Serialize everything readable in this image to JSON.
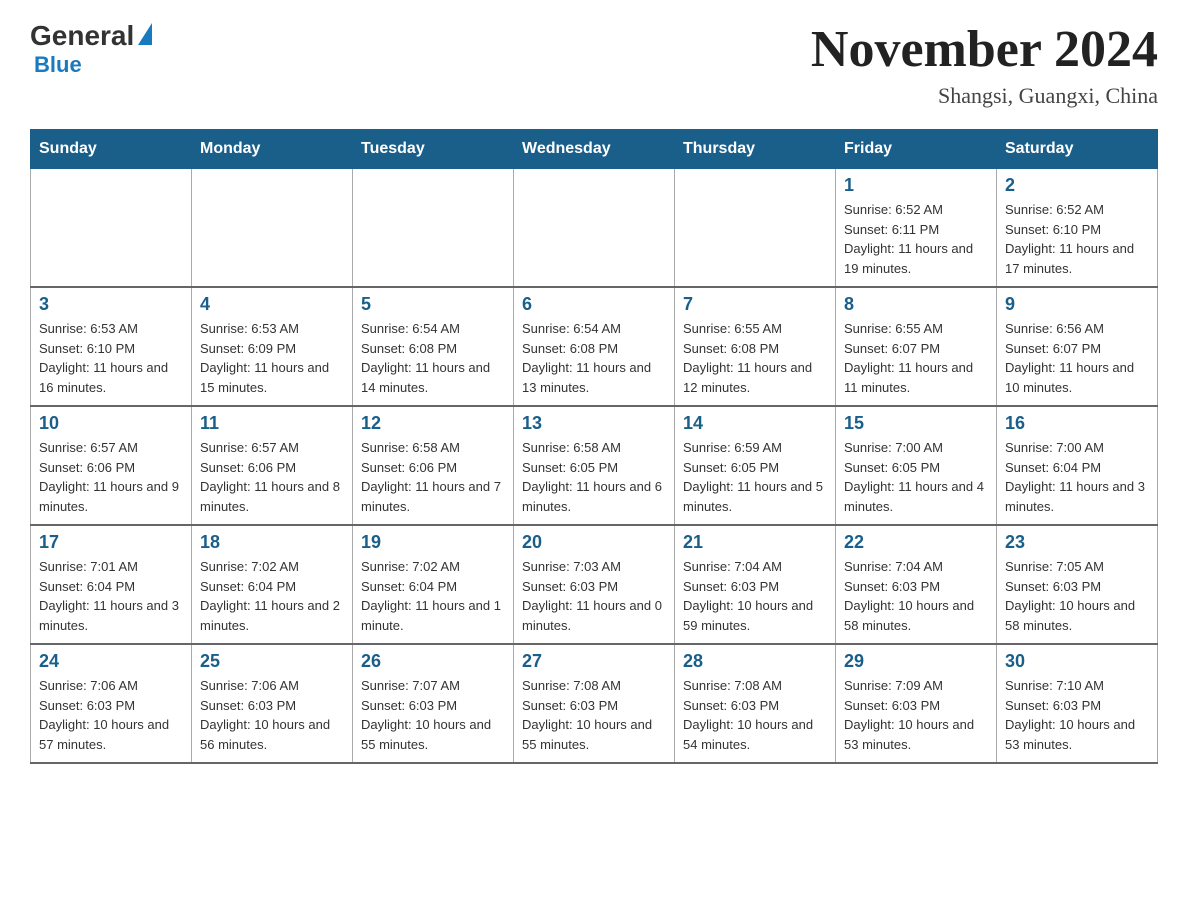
{
  "header": {
    "logo_general": "General",
    "logo_blue": "Blue",
    "month_title": "November 2024",
    "location": "Shangsi, Guangxi, China"
  },
  "days_of_week": [
    "Sunday",
    "Monday",
    "Tuesday",
    "Wednesday",
    "Thursday",
    "Friday",
    "Saturday"
  ],
  "weeks": [
    {
      "days": [
        {
          "num": "",
          "info": ""
        },
        {
          "num": "",
          "info": ""
        },
        {
          "num": "",
          "info": ""
        },
        {
          "num": "",
          "info": ""
        },
        {
          "num": "",
          "info": ""
        },
        {
          "num": "1",
          "info": "Sunrise: 6:52 AM\nSunset: 6:11 PM\nDaylight: 11 hours and 19 minutes."
        },
        {
          "num": "2",
          "info": "Sunrise: 6:52 AM\nSunset: 6:10 PM\nDaylight: 11 hours and 17 minutes."
        }
      ]
    },
    {
      "days": [
        {
          "num": "3",
          "info": "Sunrise: 6:53 AM\nSunset: 6:10 PM\nDaylight: 11 hours and 16 minutes."
        },
        {
          "num": "4",
          "info": "Sunrise: 6:53 AM\nSunset: 6:09 PM\nDaylight: 11 hours and 15 minutes."
        },
        {
          "num": "5",
          "info": "Sunrise: 6:54 AM\nSunset: 6:08 PM\nDaylight: 11 hours and 14 minutes."
        },
        {
          "num": "6",
          "info": "Sunrise: 6:54 AM\nSunset: 6:08 PM\nDaylight: 11 hours and 13 minutes."
        },
        {
          "num": "7",
          "info": "Sunrise: 6:55 AM\nSunset: 6:08 PM\nDaylight: 11 hours and 12 minutes."
        },
        {
          "num": "8",
          "info": "Sunrise: 6:55 AM\nSunset: 6:07 PM\nDaylight: 11 hours and 11 minutes."
        },
        {
          "num": "9",
          "info": "Sunrise: 6:56 AM\nSunset: 6:07 PM\nDaylight: 11 hours and 10 minutes."
        }
      ]
    },
    {
      "days": [
        {
          "num": "10",
          "info": "Sunrise: 6:57 AM\nSunset: 6:06 PM\nDaylight: 11 hours and 9 minutes."
        },
        {
          "num": "11",
          "info": "Sunrise: 6:57 AM\nSunset: 6:06 PM\nDaylight: 11 hours and 8 minutes."
        },
        {
          "num": "12",
          "info": "Sunrise: 6:58 AM\nSunset: 6:06 PM\nDaylight: 11 hours and 7 minutes."
        },
        {
          "num": "13",
          "info": "Sunrise: 6:58 AM\nSunset: 6:05 PM\nDaylight: 11 hours and 6 minutes."
        },
        {
          "num": "14",
          "info": "Sunrise: 6:59 AM\nSunset: 6:05 PM\nDaylight: 11 hours and 5 minutes."
        },
        {
          "num": "15",
          "info": "Sunrise: 7:00 AM\nSunset: 6:05 PM\nDaylight: 11 hours and 4 minutes."
        },
        {
          "num": "16",
          "info": "Sunrise: 7:00 AM\nSunset: 6:04 PM\nDaylight: 11 hours and 3 minutes."
        }
      ]
    },
    {
      "days": [
        {
          "num": "17",
          "info": "Sunrise: 7:01 AM\nSunset: 6:04 PM\nDaylight: 11 hours and 3 minutes."
        },
        {
          "num": "18",
          "info": "Sunrise: 7:02 AM\nSunset: 6:04 PM\nDaylight: 11 hours and 2 minutes."
        },
        {
          "num": "19",
          "info": "Sunrise: 7:02 AM\nSunset: 6:04 PM\nDaylight: 11 hours and 1 minute."
        },
        {
          "num": "20",
          "info": "Sunrise: 7:03 AM\nSunset: 6:03 PM\nDaylight: 11 hours and 0 minutes."
        },
        {
          "num": "21",
          "info": "Sunrise: 7:04 AM\nSunset: 6:03 PM\nDaylight: 10 hours and 59 minutes."
        },
        {
          "num": "22",
          "info": "Sunrise: 7:04 AM\nSunset: 6:03 PM\nDaylight: 10 hours and 58 minutes."
        },
        {
          "num": "23",
          "info": "Sunrise: 7:05 AM\nSunset: 6:03 PM\nDaylight: 10 hours and 58 minutes."
        }
      ]
    },
    {
      "days": [
        {
          "num": "24",
          "info": "Sunrise: 7:06 AM\nSunset: 6:03 PM\nDaylight: 10 hours and 57 minutes."
        },
        {
          "num": "25",
          "info": "Sunrise: 7:06 AM\nSunset: 6:03 PM\nDaylight: 10 hours and 56 minutes."
        },
        {
          "num": "26",
          "info": "Sunrise: 7:07 AM\nSunset: 6:03 PM\nDaylight: 10 hours and 55 minutes."
        },
        {
          "num": "27",
          "info": "Sunrise: 7:08 AM\nSunset: 6:03 PM\nDaylight: 10 hours and 55 minutes."
        },
        {
          "num": "28",
          "info": "Sunrise: 7:08 AM\nSunset: 6:03 PM\nDaylight: 10 hours and 54 minutes."
        },
        {
          "num": "29",
          "info": "Sunrise: 7:09 AM\nSunset: 6:03 PM\nDaylight: 10 hours and 53 minutes."
        },
        {
          "num": "30",
          "info": "Sunrise: 7:10 AM\nSunset: 6:03 PM\nDaylight: 10 hours and 53 minutes."
        }
      ]
    }
  ]
}
